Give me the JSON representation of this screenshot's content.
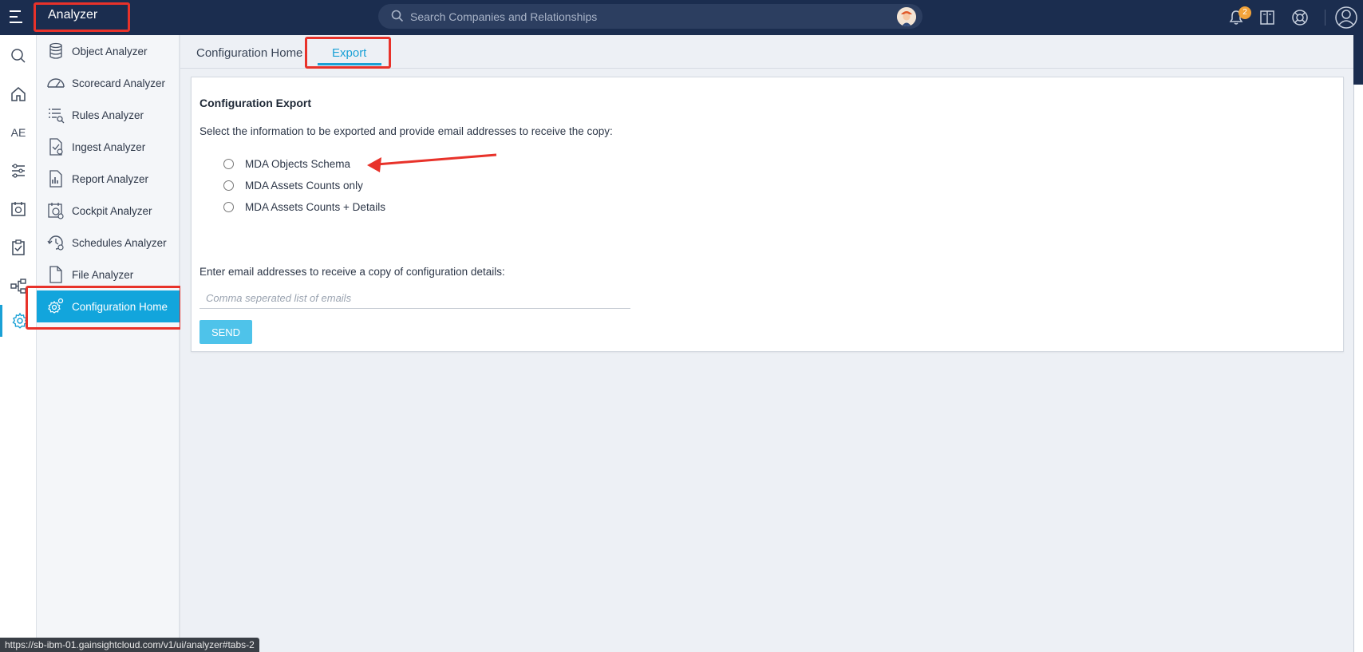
{
  "header": {
    "app_title": "Analyzer",
    "search_placeholder": "Search Companies and Relationships",
    "notification_count": "2"
  },
  "rail": {
    "items": [
      {
        "icon": "search-icon"
      },
      {
        "icon": "home-icon"
      },
      {
        "text": "AE"
      },
      {
        "icon": "rules-icon"
      },
      {
        "icon": "calendar-icon"
      },
      {
        "icon": "clipboard-icon"
      },
      {
        "icon": "flow-icon"
      },
      {
        "icon": "gear-icon",
        "active": true
      }
    ]
  },
  "subnav": {
    "items": [
      {
        "label": "Object Analyzer",
        "icon": "database-icon"
      },
      {
        "label": "Scorecard Analyzer",
        "icon": "gauge-icon"
      },
      {
        "label": "Rules Analyzer",
        "icon": "list-search-icon"
      },
      {
        "label": "Ingest Analyzer",
        "icon": "file-import-icon"
      },
      {
        "label": "Report Analyzer",
        "icon": "report-icon"
      },
      {
        "label": "Cockpit Analyzer",
        "icon": "cockpit-icon"
      },
      {
        "label": "Schedules Analyzer",
        "icon": "schedule-icon"
      },
      {
        "label": "File Analyzer",
        "icon": "file-icon"
      },
      {
        "label": "Configuration Home",
        "icon": "gear-icon",
        "active": true
      }
    ]
  },
  "tabs": {
    "items": [
      {
        "label": "Configuration Home"
      },
      {
        "label": "Export",
        "active": true
      }
    ]
  },
  "export_panel": {
    "title": "Configuration Export",
    "description": "Select the information to be exported and provide email addresses to receive the copy:",
    "options": [
      {
        "label": "MDA Objects Schema",
        "checked": false
      },
      {
        "label": "MDA Assets Counts only",
        "checked": false
      },
      {
        "label": "MDA Assets Counts + Details",
        "checked": false
      }
    ],
    "email_label": "Enter email addresses to receive a copy of configuration details:",
    "email_placeholder": "Comma seperated list of emails",
    "email_value": "",
    "send_label": "SEND"
  },
  "status_bar": {
    "url": "https://sb-ibm-01.gainsightcloud.com/v1/ui/analyzer#tabs-2"
  },
  "colors": {
    "topbar": "#1b2d4f",
    "accent": "#1aa1d6",
    "active_nav": "#12a5dc",
    "send_button": "#4ec3ea",
    "highlight": "#e8322a",
    "badge": "#f2a33a"
  }
}
